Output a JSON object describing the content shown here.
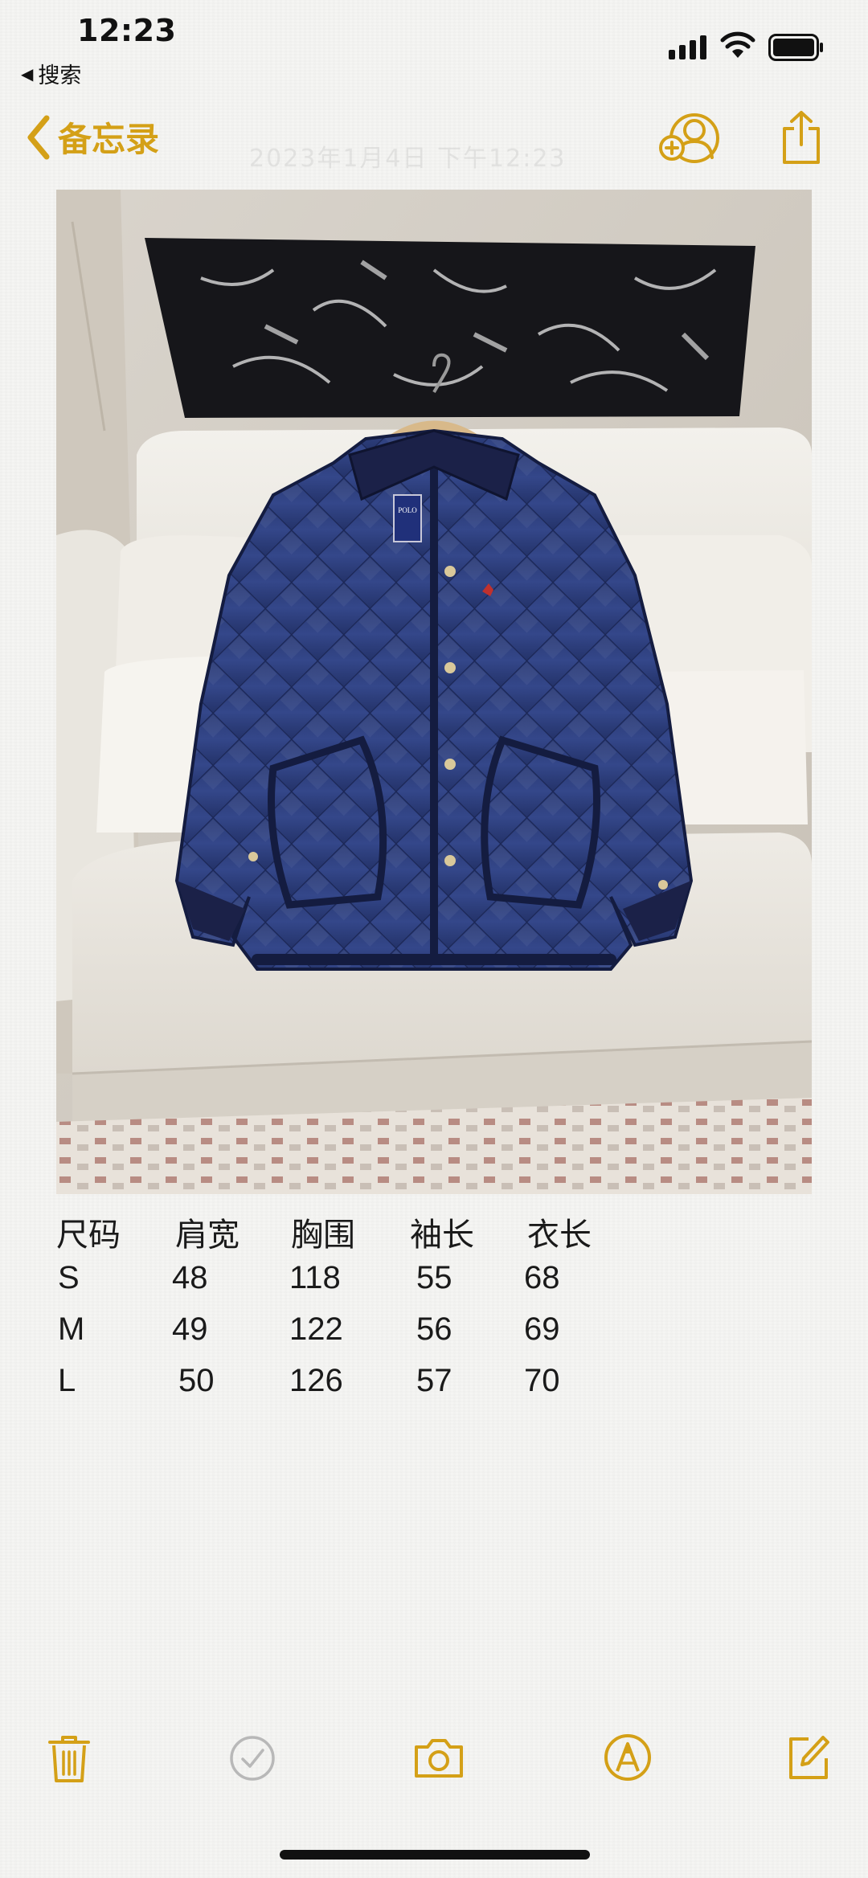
{
  "status_bar": {
    "time": "12:23",
    "back_app": "搜索",
    "icons": [
      "signal-icon",
      "wifi-icon",
      "battery-icon"
    ]
  },
  "nav": {
    "back_label": "备忘录",
    "date_faint": "2023年1月4日 下午12:23",
    "icons": [
      "collaborate-icon",
      "share-icon"
    ]
  },
  "photo": {
    "description_icon": "jacket-photo",
    "brand_tag": "POLO"
  },
  "size_table": {
    "headers": [
      "尺码",
      "肩宽",
      "胸围",
      "袖长",
      "衣长"
    ],
    "rows": [
      [
        "S",
        "48",
        "118",
        "55",
        "68"
      ],
      [
        "M",
        "49",
        "122",
        "56",
        "69"
      ],
      [
        "L",
        "50",
        "126",
        "57",
        "70"
      ]
    ]
  },
  "toolbar": {
    "icons": [
      "trash-icon",
      "checklist-icon",
      "camera-icon",
      "markup-icon",
      "compose-icon"
    ]
  },
  "colors": {
    "accent": "#d4a017",
    "checklist_gray": "#b8b8b8"
  }
}
